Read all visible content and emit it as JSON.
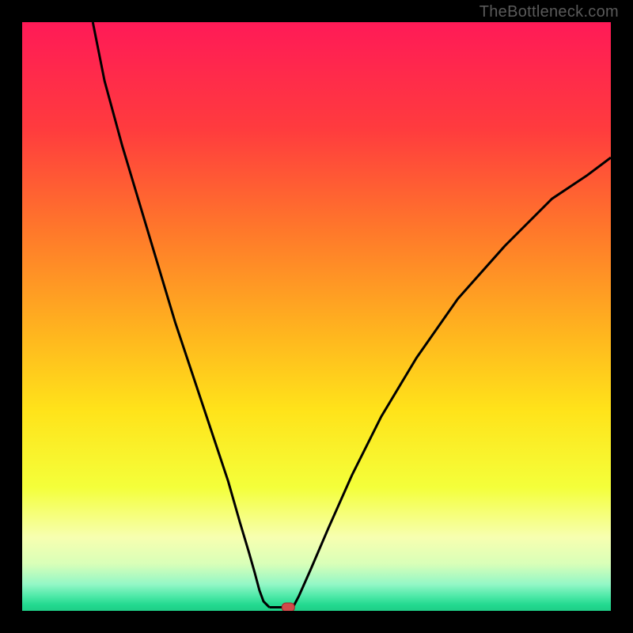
{
  "watermark": "TheBottleneck.com",
  "colors": {
    "frame": "#000000",
    "curve": "#000000",
    "dot_fill": "#d24a4a",
    "dot_stroke": "#9b2c2c",
    "gradient_stops": [
      {
        "offset": 0.0,
        "color": "#ff1a57"
      },
      {
        "offset": 0.18,
        "color": "#ff3b3e"
      },
      {
        "offset": 0.36,
        "color": "#ff7a2a"
      },
      {
        "offset": 0.52,
        "color": "#ffb21f"
      },
      {
        "offset": 0.66,
        "color": "#ffe31a"
      },
      {
        "offset": 0.79,
        "color": "#f4ff3a"
      },
      {
        "offset": 0.875,
        "color": "#f7ffb0"
      },
      {
        "offset": 0.92,
        "color": "#d9ffb8"
      },
      {
        "offset": 0.955,
        "color": "#93f7c6"
      },
      {
        "offset": 0.975,
        "color": "#4ee9a8"
      },
      {
        "offset": 0.99,
        "color": "#22d98f"
      },
      {
        "offset": 1.0,
        "color": "#1fce87"
      }
    ]
  },
  "chart_data": {
    "type": "line",
    "title": "",
    "xlabel": "",
    "ylabel": "",
    "xlim": [
      0,
      100
    ],
    "ylim": [
      0,
      100
    ],
    "grid": false,
    "legend": false,
    "series": [
      {
        "name": "left-branch",
        "x": [
          12,
          14,
          17,
          20,
          23,
          26,
          29,
          32,
          35,
          37,
          38.5,
          39.5,
          40.3,
          41.0,
          42.0
        ],
        "y": [
          100,
          90,
          79,
          69,
          59,
          49,
          40,
          31,
          22,
          15,
          10,
          6.5,
          3.5,
          1.6,
          0.6
        ]
      },
      {
        "name": "right-branch",
        "x": [
          46,
          47,
          49,
          52,
          56,
          61,
          67,
          74,
          82,
          90,
          96,
          100
        ],
        "y": [
          0.6,
          2.5,
          7,
          14,
          23,
          33,
          43,
          53,
          62,
          70,
          74,
          77
        ]
      }
    ],
    "annotations": [
      {
        "name": "valley-floor-segment",
        "x0": 42.0,
        "x1": 46.0,
        "y": 0.6
      },
      {
        "name": "minimum-dot",
        "x": 45.2,
        "y": 0.6
      }
    ]
  }
}
